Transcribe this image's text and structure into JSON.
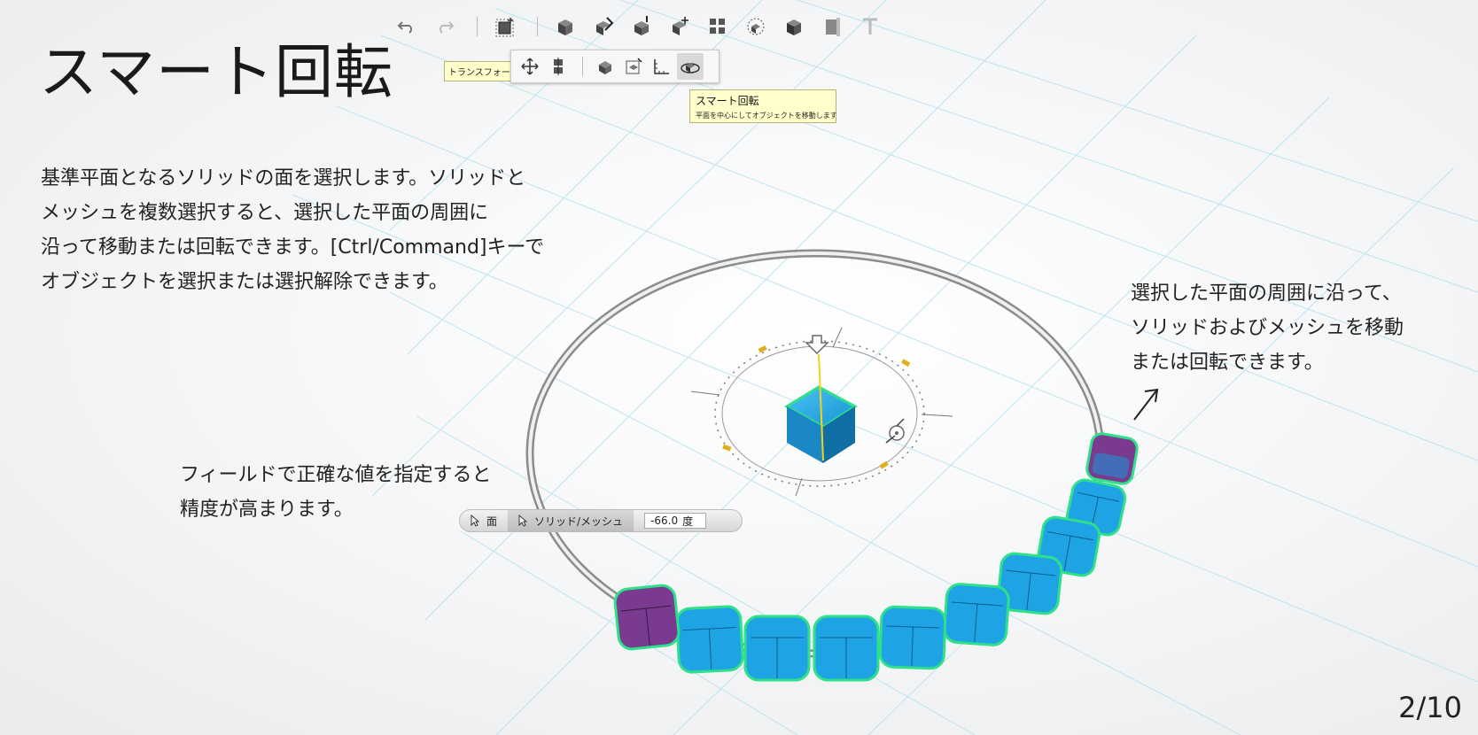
{
  "title": "スマート回転",
  "description": [
    "基準平面となるソリッドの面を選択します。ソリッドと",
    "メッシュを複数選択すると、選択した平面の周囲に",
    "沿って移動または回転できます。[Ctrl/Command]キーで",
    "オブジェクトを選択または選択解除できます。"
  ],
  "note_right": [
    "選択した平面の周囲に沿って、",
    "ソリッドおよびメッシュを移動",
    "または回転できます。"
  ],
  "note_left": [
    "フィールドで正確な値を指定すると",
    "精度が高まります。"
  ],
  "page_number": "2/10",
  "toolbar": {
    "icons": [
      "undo-icon",
      "redo-icon",
      "transform-icon",
      "primitives-icon",
      "sketch-icon",
      "construct-icon",
      "modify-icon",
      "pattern-icon",
      "group-icon",
      "combine-icon",
      "measure-icon",
      "text-icon"
    ],
    "transform_tooltip": "トランスフォーム"
  },
  "subtoolbar": {
    "icons": [
      "move-icon",
      "align-icon",
      "scale-icon",
      "smart-scale-icon",
      "ruler-icon",
      "smart-rotate-icon"
    ],
    "active": "smart-rotate-icon"
  },
  "tooltip": {
    "title": "スマート回転",
    "subtitle": "平面を中心にしてオブジェクトを移動します"
  },
  "fieldbar": {
    "face_label": "面",
    "solid_mesh_label": "ソリッド/メッシュ",
    "value": "-66.0",
    "unit": "度"
  },
  "colors": {
    "cube_blue": "#1ea3e4",
    "cube_purple": "#7a3a8f",
    "selection_green": "#2fe08a",
    "grid": "#a9dcef"
  }
}
